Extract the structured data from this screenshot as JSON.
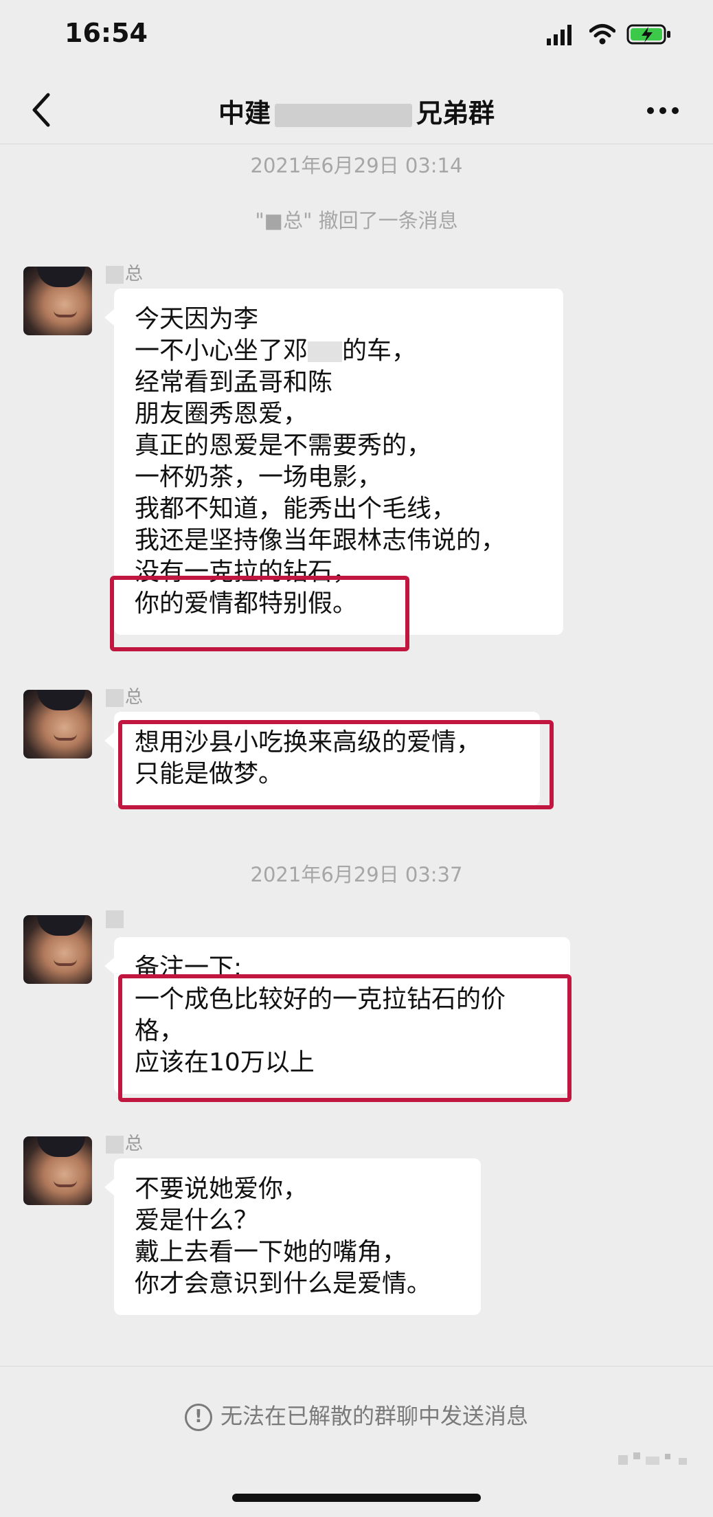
{
  "status_bar": {
    "time": "16:54",
    "icons": [
      "signal-icon",
      "wifi-icon",
      "battery-charging-icon"
    ]
  },
  "nav": {
    "title_start": "中建",
    "title_end": "兄弟群",
    "back_icon": "chevron-left-icon",
    "more_icon": "more-dots-icon"
  },
  "chat": {
    "timestamp_1": "2021年6月29日 03:14",
    "recall_notice": "\"■总\" 撤回了一条消息",
    "messages": [
      {
        "sender": "总",
        "lines": [
          "今天因为李",
          "一不小心坐了邓",
          "经常看到孟哥和陈",
          "朋友圈秀恩爱，",
          "真正的恩爱是不需要秀的，",
          "一杯奶茶，一场电影，",
          "我都不知道，能秀出个毛线，",
          "我还是坚持像当年跟林志伟说的，",
          "没有一克拉的钻石，",
          "你的爱情都特别假。"
        ],
        "tail_2": "的车，"
      },
      {
        "sender": "总",
        "lines": [
          "想用沙县小吃换来高级的爱情，",
          "只能是做梦。"
        ]
      },
      {
        "sender": "",
        "lines": [
          "备注一下:",
          "一个成色比较好的一克拉钻石的价",
          "格，",
          "应该在10万以上"
        ]
      },
      {
        "sender": "总",
        "lines": [
          "不要说她爱你，",
          "爱是什么？",
          "戴上去看一下她的嘴角，",
          "你才会意识到什么是爱情。"
        ]
      }
    ],
    "timestamp_2": "2021年6月29日 03:37"
  },
  "footer": {
    "notice": "无法在已解散的群聊中发送消息",
    "info_icon": "!"
  },
  "colors": {
    "background": "#ededed",
    "bubble": "#ffffff",
    "highlight_box": "#c0163f",
    "timestamp": "#a6a6a6"
  }
}
